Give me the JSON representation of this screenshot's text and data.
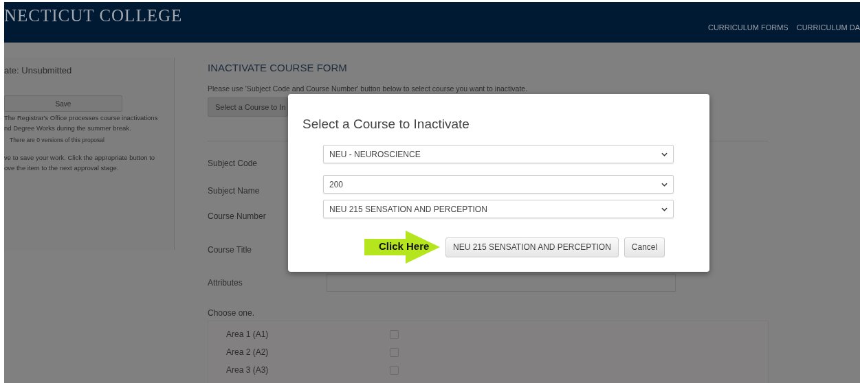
{
  "header": {
    "logo": "NECTICUT COLLEGE",
    "nav": [
      "CURRICULUM FORMS",
      "CURRICULUM DA"
    ]
  },
  "sidebar": {
    "state": "ate: Unsubmitted",
    "save_button": "Save",
    "notice": "The Registrar's Office processes course inactivations\nnd Degree Works during the summer break.",
    "versions": "There are 0 versions of this proposal",
    "help": "ve to save your work. Click the appropriate button to\nove the item to the next approval stage."
  },
  "form": {
    "title": "INACTIVATE COURSE FORM",
    "instructions": "Please use 'Subject Code and Course Number' button below to select course you want to inactivate.",
    "select_button": "Select a Course to In",
    "fields": [
      {
        "label": "Subject Code",
        "kind": "text"
      },
      {
        "label": "Subject Name",
        "kind": "text"
      },
      {
        "label": "Course Number",
        "kind": "text"
      },
      {
        "label": "Course Title",
        "kind": "text"
      },
      {
        "label": "Attributes",
        "kind": "input"
      }
    ],
    "choose_label": "Choose one.",
    "areas": [
      {
        "label": "Area 1 (A1)",
        "checked": false
      },
      {
        "label": "Area 2 (A2)",
        "checked": false
      },
      {
        "label": "Area 3 (A3)",
        "checked": false
      }
    ]
  },
  "modal": {
    "title": "Select a Course to Inactivate",
    "selects": [
      "NEU - NEUROSCIENCE",
      "200",
      "NEU 215 SENSATION AND PERCEPTION"
    ],
    "callout": "Click Here",
    "buttons": [
      "NEU 215 SENSATION AND PERCEPTION",
      "Cancel"
    ]
  }
}
